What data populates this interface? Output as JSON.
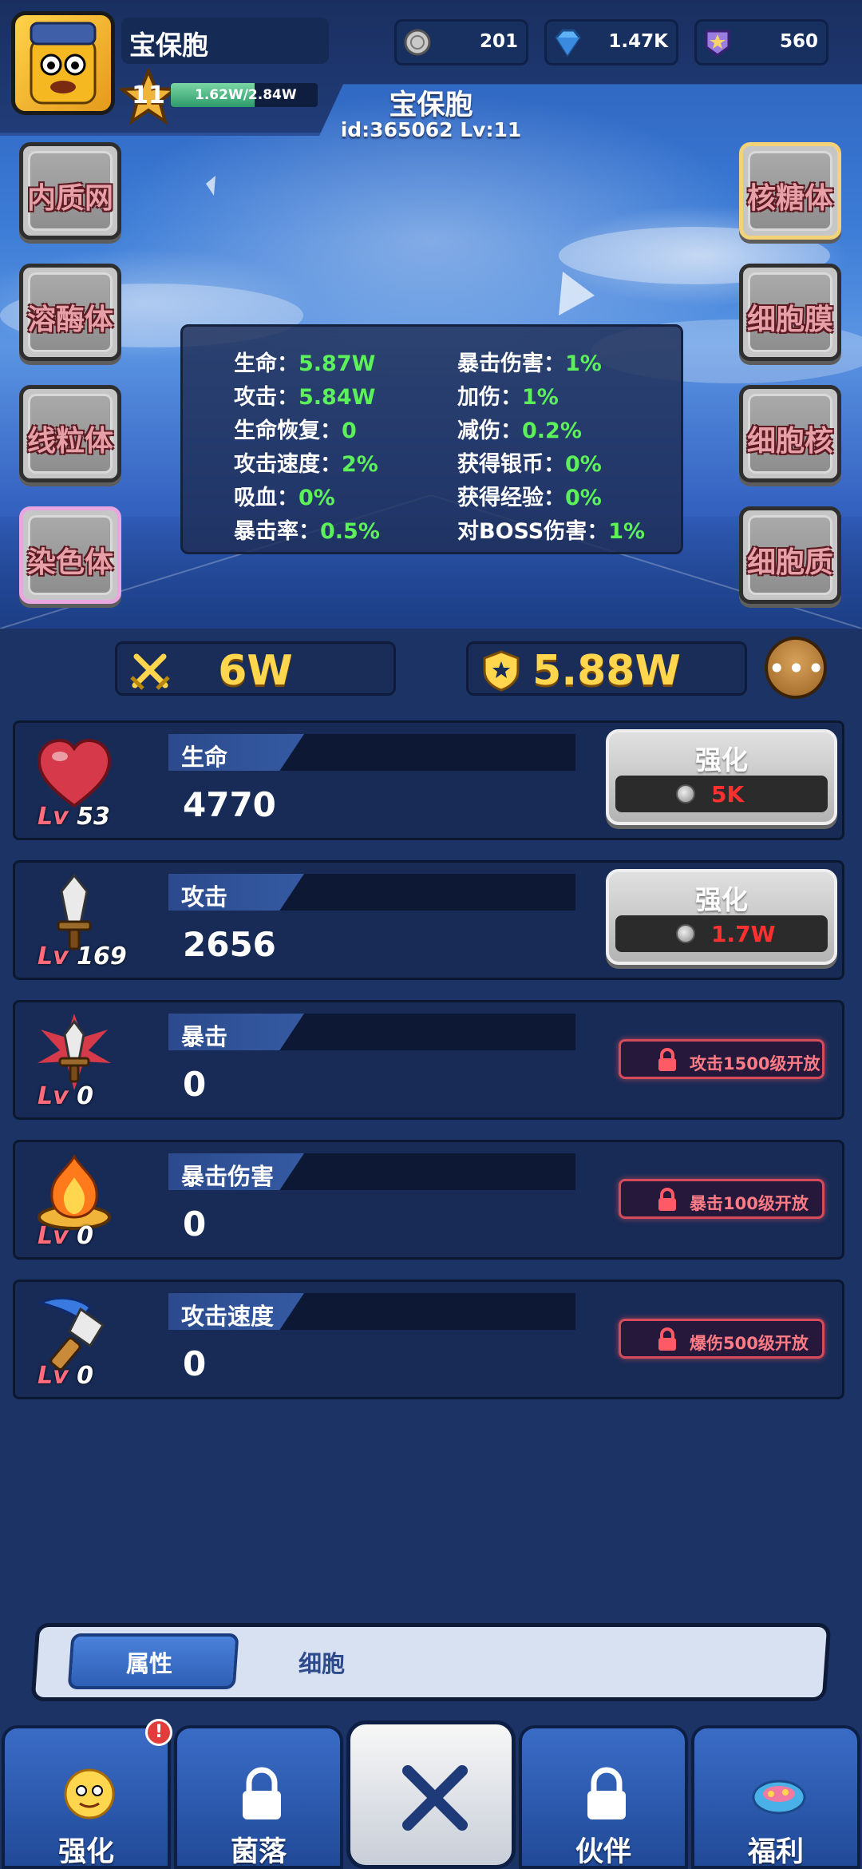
{
  "header": {
    "player_name": "宝保胞",
    "level": "11",
    "exp_text": "1.62W/2.84W",
    "exp_progress": 0.57,
    "currencies": [
      {
        "icon": "silver-coin-icon",
        "value": "201"
      },
      {
        "icon": "diamond-icon",
        "value": "1.47K"
      },
      {
        "icon": "star-badge-icon",
        "value": "560"
      }
    ],
    "center_name": "宝保胞",
    "center_id": "id:365062  Lv:11"
  },
  "organelles": {
    "left": [
      "内质网",
      "溶酶体",
      "线粒体",
      "染色体"
    ],
    "right": [
      "核糖体",
      "细胞膜",
      "细胞核",
      "细胞质"
    ]
  },
  "stats": {
    "left": [
      {
        "label": "生命：",
        "value": "5.87W"
      },
      {
        "label": "攻击：",
        "value": "5.84W"
      },
      {
        "label": "生命恢复：",
        "value": "0"
      },
      {
        "label": "攻击速度：",
        "value": "2%"
      },
      {
        "label": "吸血：",
        "value": "0%"
      },
      {
        "label": "暴击率：",
        "value": "0.5%"
      }
    ],
    "right": [
      {
        "label": "暴击伤害：",
        "value": "1%"
      },
      {
        "label": "加伤：",
        "value": "1%"
      },
      {
        "label": "减伤：",
        "value": "0.2%"
      },
      {
        "label": "获得银币：",
        "value": "0%"
      },
      {
        "label": "获得经验：",
        "value": "0%"
      },
      {
        "label": "对BOSS伤害：",
        "value": "1%"
      }
    ]
  },
  "power": {
    "attack_power": "6W",
    "defense_power": "5.88W",
    "more_icon": "more-dots-icon"
  },
  "upgrades": [
    {
      "name": "生命",
      "level": "53",
      "value": "4770",
      "icon": "heart-icon",
      "button": "强化",
      "cost": "5K",
      "locked": false
    },
    {
      "name": "攻击",
      "level": "169",
      "value": "2656",
      "icon": "sword-icon",
      "button": "强化",
      "cost": "1.7W",
      "locked": false
    },
    {
      "name": "暴击",
      "level": "0",
      "value": "0",
      "icon": "crit-sword-icon",
      "lock_text": "攻击1500级开放",
      "locked": true
    },
    {
      "name": "暴击伤害",
      "level": "0",
      "value": "0",
      "icon": "fire-icon",
      "lock_text": "暴击100级开放",
      "locked": true
    },
    {
      "name": "攻击速度",
      "level": "0",
      "value": "0",
      "icon": "axe-icon",
      "lock_text": "爆伤500级开放",
      "locked": true
    }
  ],
  "lv_prefix": "Lv",
  "subtabs": [
    "属性",
    "细胞"
  ],
  "nav": [
    {
      "label": "强化",
      "icon": "character-icon",
      "badge": "!"
    },
    {
      "label": "菌落",
      "icon": "lock-icon"
    },
    {
      "label": "",
      "icon": "close-icon"
    },
    {
      "label": "伙伴",
      "icon": "lock-icon"
    },
    {
      "label": "福利",
      "icon": "gift-icon"
    }
  ],
  "colors": {
    "stat_value": "#5cf05a",
    "power_text": "#ffd64d",
    "cost_text": "#ff3030",
    "lock_text": "#ff7c86"
  }
}
